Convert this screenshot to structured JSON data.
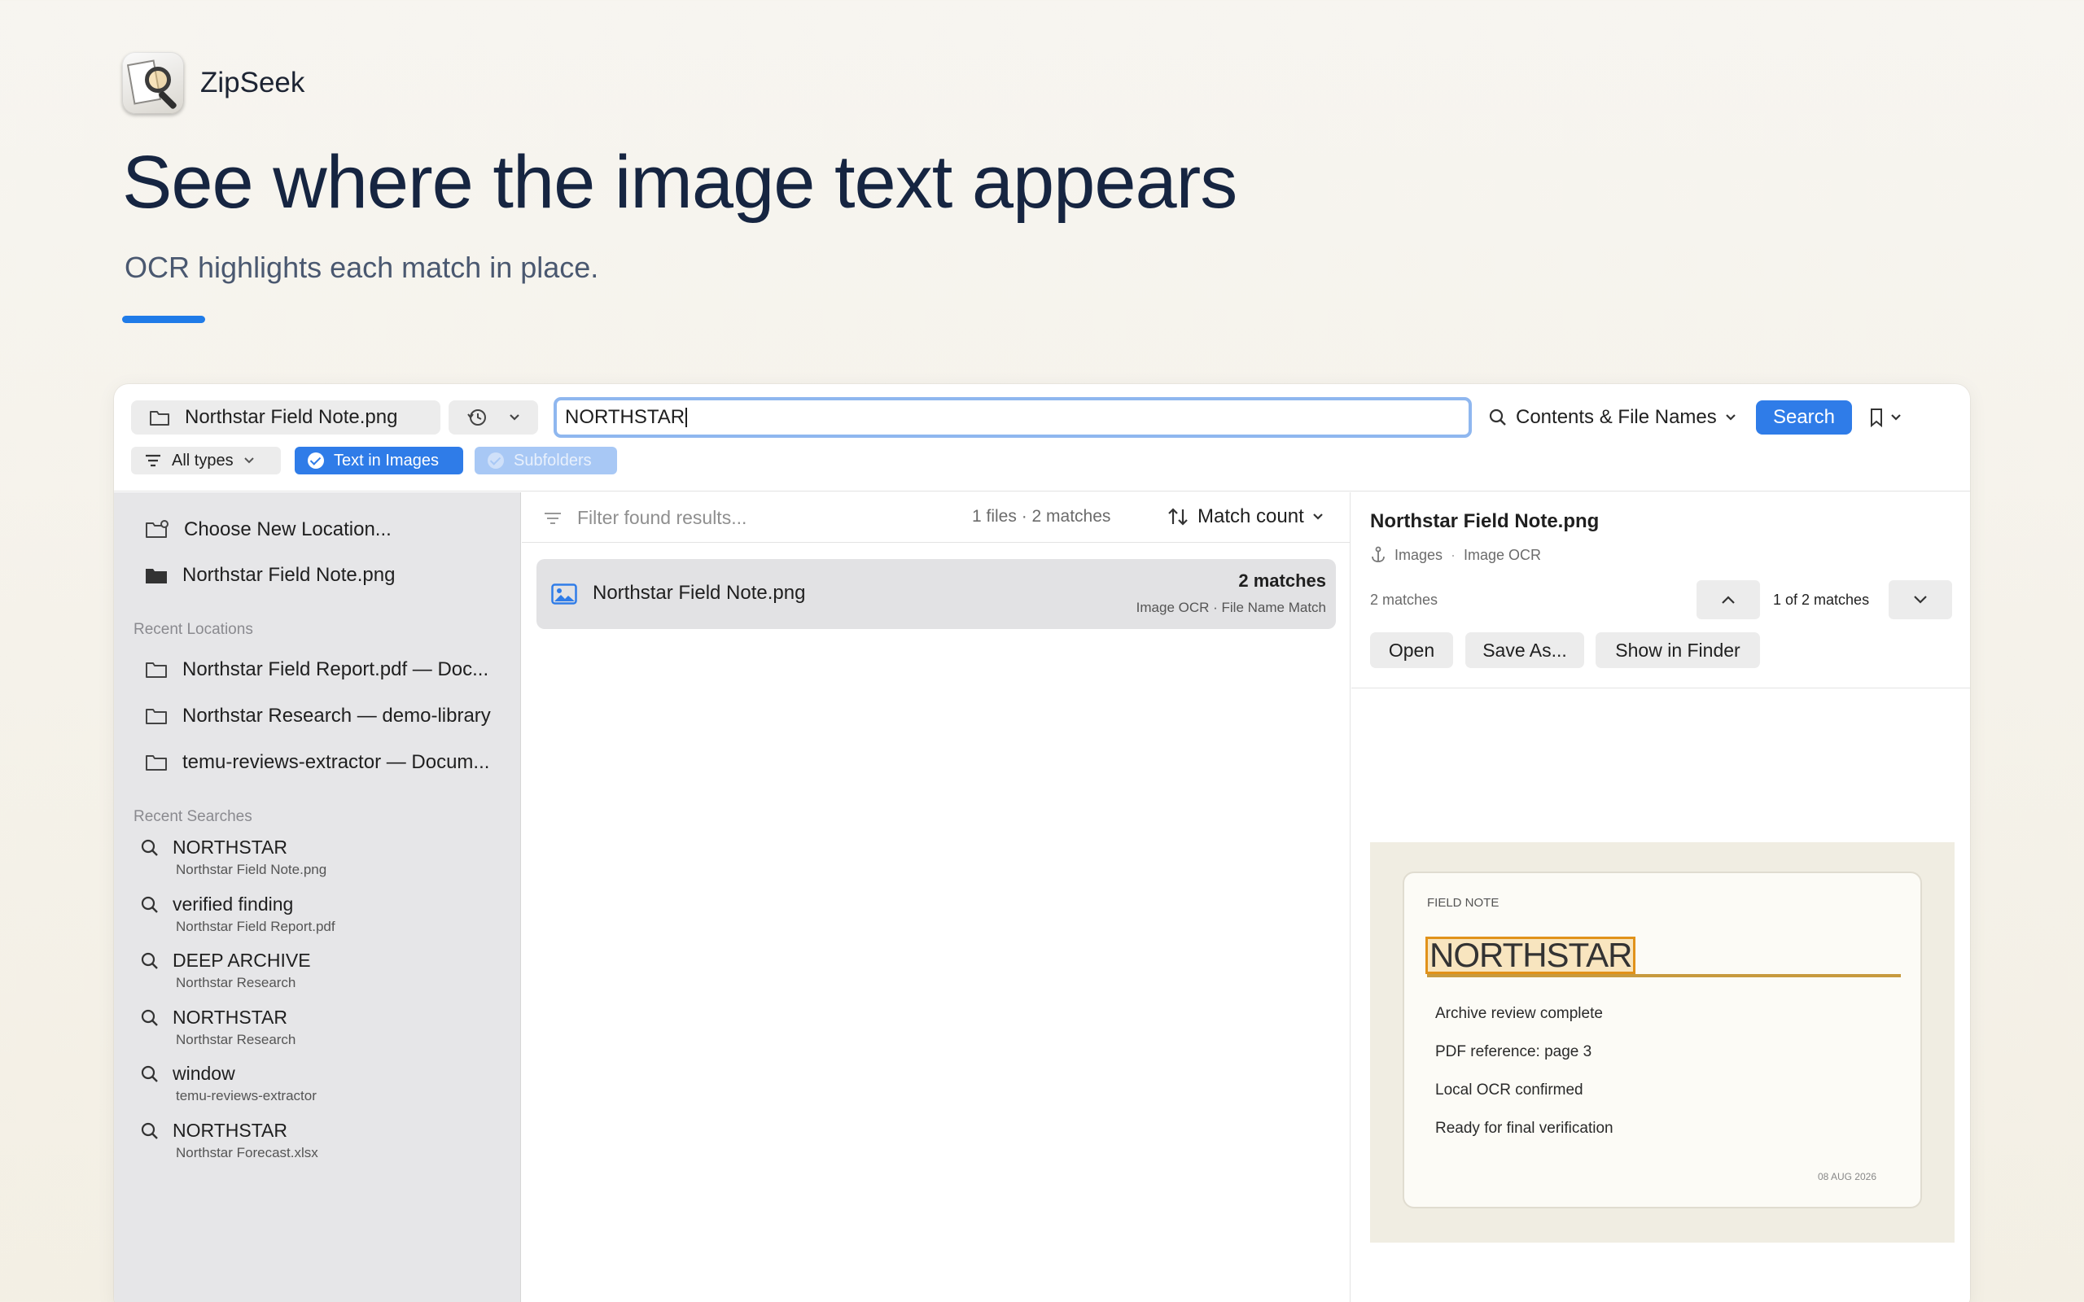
{
  "brand": {
    "name": "ZipSeek"
  },
  "hero": {
    "title": "See where the image text appears",
    "subtitle": "OCR highlights each match in place."
  },
  "toolbar": {
    "location": "Northstar Field Note.png",
    "search_value": "NORTHSTAR",
    "scope": "Contents & File Names",
    "search_label": "Search",
    "filters": {
      "types": "All types",
      "ocr": "Text in Images",
      "subfolders": "Subfolders"
    }
  },
  "sidebar": {
    "choose_location": "Choose New Location...",
    "current": "Northstar Field Note.png",
    "recent_locations_heading": "Recent Locations",
    "recent_locations": [
      "Northstar Field Report.pdf — Doc...",
      "Northstar Research — demo-library",
      "temu-reviews-extractor — Docum..."
    ],
    "recent_searches_heading": "Recent Searches",
    "recent_searches": [
      {
        "query": "NORTHSTAR",
        "location": "Northstar Field Note.png"
      },
      {
        "query": "verified finding",
        "location": "Northstar Field Report.pdf"
      },
      {
        "query": "DEEP ARCHIVE",
        "location": "Northstar Research"
      },
      {
        "query": "NORTHSTAR",
        "location": "Northstar Research"
      },
      {
        "query": "window",
        "location": "temu-reviews-extractor"
      },
      {
        "query": "NORTHSTAR",
        "location": "Northstar Forecast.xlsx"
      }
    ]
  },
  "results": {
    "filter_placeholder": "Filter found results...",
    "summary": "1 files · 2 matches",
    "sort_label": "Match count",
    "items": [
      {
        "name": "Northstar Field Note.png",
        "matches": "2 matches",
        "kinds": "Image OCR · File Name Match"
      }
    ]
  },
  "preview": {
    "title": "Northstar Field Note.png",
    "folder": "Images",
    "kind": "Image OCR",
    "match_count": "2 matches",
    "position": "1 of 2 matches",
    "actions": {
      "open": "Open",
      "save_as": "Save As...",
      "show_in_finder": "Show in Finder"
    },
    "note": {
      "kicker": "FIELD NOTE",
      "headline": "NORTHSTAR",
      "lines": [
        "Archive review complete",
        "PDF reference: page 3",
        "Local OCR confirmed",
        "Ready for final verification"
      ],
      "date": "08 AUG 2026"
    }
  },
  "colors": {
    "accent": "#2f7ce8",
    "highlight": "#e1921a",
    "sidebar_bg": "#e6e6e8"
  }
}
